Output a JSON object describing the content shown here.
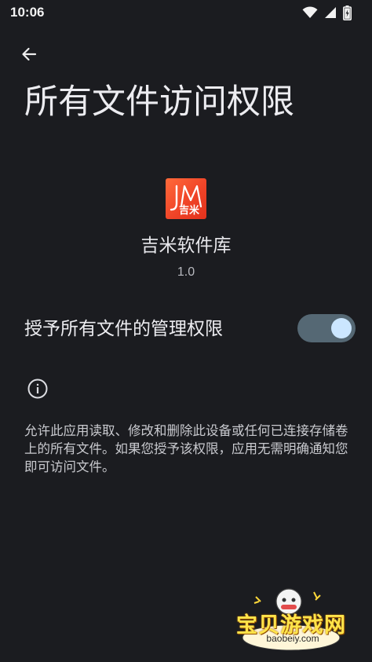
{
  "status_bar": {
    "time": "10:06"
  },
  "header": {
    "title": "所有文件访问权限"
  },
  "app": {
    "name": "吉米软件库",
    "version": "1.0",
    "icon_letters": "JM",
    "icon_subtext": "吉米"
  },
  "permission": {
    "label": "授予所有文件的管理权限",
    "enabled": true
  },
  "info": {
    "description": "允许此应用读取、修改和删除此设备或任何已连接存储卷上的所有文件。如果您授予该权限，应用无需明确通知您即可访问文件。"
  },
  "watermark": {
    "text": "宝贝游戏网",
    "url": "baobeiy.com"
  },
  "colors": {
    "background": "#1b1c20",
    "toggle_track": "#556874",
    "toggle_thumb": "#cbe6ff",
    "app_icon": "#f04428"
  },
  "icons": {
    "back": "arrow-left-icon",
    "info": "info-icon",
    "wifi": "wifi-icon",
    "signal": "signal-icon",
    "battery": "battery-icon"
  }
}
